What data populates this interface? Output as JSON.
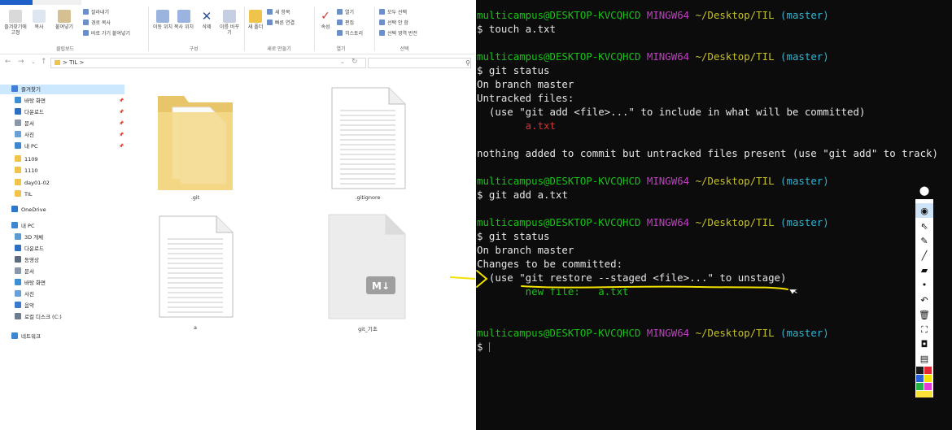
{
  "colors": {
    "terminal_bg": "#0c0c0c",
    "prompt_user": "#19c219",
    "prompt_mingw": "#c03ec3",
    "prompt_path": "#c6c02a",
    "prompt_branch": "#33b5d1",
    "untracked_file": "#d53434",
    "staged_file": "#19c219",
    "annotation": "#f2e200",
    "folder": "#f4d98a",
    "selected_nav": "#cce8ff"
  },
  "ribbon": {
    "buttons": [
      {
        "label": "즐겨찾기에 고정",
        "icon": "pin-icon"
      },
      {
        "label": "복사",
        "icon": "copy-icon"
      },
      {
        "label": "붙여넣기",
        "icon": "paste-icon"
      },
      {
        "label": "이동 위치",
        "icon": "move-to-icon"
      },
      {
        "label": "복사 위치",
        "icon": "copy-to-icon"
      },
      {
        "label": "삭제",
        "icon": "delete-icon"
      },
      {
        "label": "이름 바꾸기",
        "icon": "rename-icon"
      },
      {
        "label": "새 폴더",
        "icon": "new-folder-icon"
      },
      {
        "label": "속성",
        "icon": "properties-icon"
      }
    ],
    "small_items": [
      "잘라내기",
      "경로 복사",
      "바로 가기 붙여넣기",
      "새 항목",
      "빠른 연결",
      "열기",
      "편집",
      "히스토리",
      "모두 선택",
      "선택 안 함",
      "선택 영역 반전"
    ],
    "groups": [
      "클립보드",
      "구성",
      "새로 만들기",
      "열기",
      "선택"
    ]
  },
  "address": {
    "path": "> TIL >",
    "search_icon": "search-icon"
  },
  "nav": {
    "items": [
      {
        "label": "즐겨찾기",
        "icon": "star-icon",
        "selected": true
      },
      {
        "label": "바탕 화면",
        "icon": "desktop-icon",
        "pinned": true
      },
      {
        "label": "다운로드",
        "icon": "download-icon",
        "pinned": true
      },
      {
        "label": "문서",
        "icon": "document-icon",
        "pinned": true
      },
      {
        "label": "사진",
        "icon": "picture-icon",
        "pinned": true
      },
      {
        "label": "내 PC",
        "icon": "pc-icon",
        "pinned": true
      },
      {
        "label": "1109",
        "icon": "folder-icon"
      },
      {
        "label": "1110",
        "icon": "folder-icon"
      },
      {
        "label": "day01-02",
        "icon": "folder-icon"
      },
      {
        "label": "TIL",
        "icon": "folder-icon"
      },
      {
        "label": "OneDrive",
        "icon": "cloud-icon"
      },
      {
        "label": "내 PC",
        "icon": "pc-icon"
      },
      {
        "label": "3D 개체",
        "icon": "cube-icon"
      },
      {
        "label": "다운로드",
        "icon": "download-icon"
      },
      {
        "label": "동영상",
        "icon": "video-icon"
      },
      {
        "label": "문서",
        "icon": "document-icon"
      },
      {
        "label": "바탕 화면",
        "icon": "desktop-icon"
      },
      {
        "label": "사진",
        "icon": "picture-icon"
      },
      {
        "label": "음악",
        "icon": "music-icon"
      },
      {
        "label": "로컬 디스크 (C:)",
        "icon": "disk-icon"
      },
      {
        "label": "네트워크",
        "icon": "network-icon"
      }
    ]
  },
  "files": [
    {
      "name": ".git",
      "icon": "folder-icon"
    },
    {
      "name": ".gitignore",
      "icon": "text-file-icon"
    },
    {
      "name": "a",
      "icon": "text-file-icon"
    },
    {
      "name": "git_기초",
      "icon": "markdown-file-icon"
    }
  ],
  "terminal": {
    "prompt": {
      "user": "multicampus@DESKTOP-KVCQHCD",
      "env": "MINGW64",
      "path": "~/Desktop/TIL",
      "branch": "(master)"
    },
    "commands": [
      "touch a.txt",
      "git status",
      "git add a.txt",
      "git status"
    ],
    "output": {
      "on_branch": "On branch master",
      "untracked_header": "Untracked files:",
      "untracked_hint": "  (use \"git add <file>...\" to include in what will be committed)",
      "untracked_file": "        a.txt",
      "nothing_added": "nothing added to commit but untracked files present (use \"git add\" to track)",
      "changes_header": "Changes to be committed:",
      "restore_hint": "  (use \"git restore --staged <file>...\" to unstage)",
      "new_file": "        new file:   a.txt"
    },
    "dollar": "$ "
  },
  "draw_tools": [
    "pin-icon",
    "eye-icon",
    "pointer-icon",
    "pen-icon",
    "marker-icon",
    "eraser-icon",
    "dot-icon",
    "undo-icon",
    "trash-icon",
    "screenshot-icon",
    "camera-icon",
    "clipboard-icon"
  ],
  "palette": [
    "#1a1a1a",
    "#e3262f",
    "#2a62d9",
    "#f4e400",
    "#24b24a",
    "#e43ad8",
    "#f7f7f7",
    "#fae23a"
  ]
}
